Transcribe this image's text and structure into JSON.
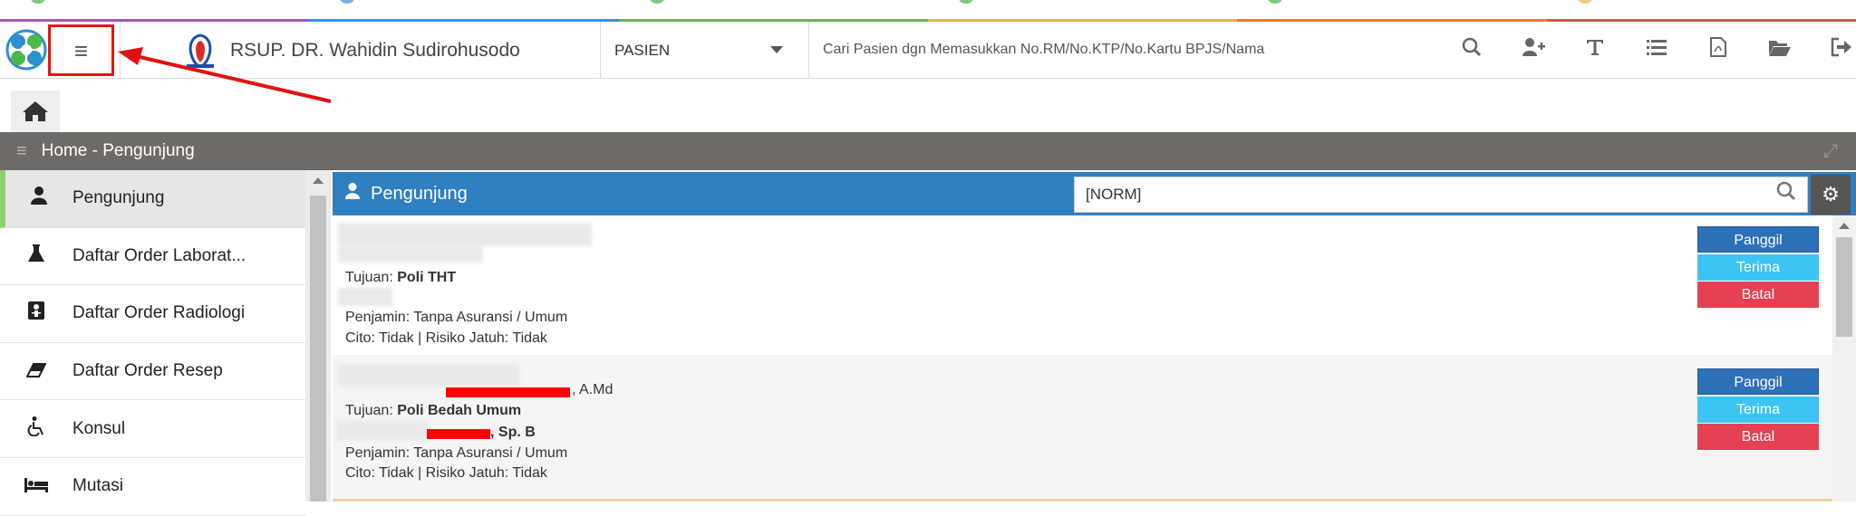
{
  "header": {
    "hospital_name": "RSUP. DR. Wahidin Sudirohusodo",
    "search_type": "PASIEN",
    "search_placeholder": "Cari Pasien dgn Memasukkan No.RM/No.KTP/No.Kartu BPJS/Nama",
    "menu_icon": "hamburger-icon",
    "toolbar_icons": [
      "search-icon",
      "add-user-icon",
      "text-icon",
      "list-icon",
      "pdf-icon",
      "folder-icon",
      "logout-icon"
    ]
  },
  "titlebar": {
    "title": "Home - Pengunjung"
  },
  "sidebar": {
    "items": [
      {
        "label": "Pengunjung",
        "icon": "user-icon",
        "active": true
      },
      {
        "label": "Daftar Order Laborat...",
        "icon": "flask-icon",
        "active": false
      },
      {
        "label": "Daftar Order Radiologi",
        "icon": "xray-icon",
        "active": false
      },
      {
        "label": "Daftar Order Resep",
        "icon": "eraser-icon",
        "active": false
      },
      {
        "label": "Konsul",
        "icon": "wheelchair-icon",
        "active": false
      },
      {
        "label": "Mutasi",
        "icon": "bed-icon",
        "active": false
      }
    ]
  },
  "panel": {
    "title": "Pengunjung",
    "norm_value": "[NORM]"
  },
  "visits": [
    {
      "name_suffix": "",
      "tujuan_label": "Tujuan: ",
      "tujuan": "Poli THT",
      "doctor_suffix": "",
      "penjamin": "Penjamin: Tanpa Asuransi / Umum",
      "cito": "Cito: Tidak | Risiko Jatuh: Tidak"
    },
    {
      "name_suffix": ", A.Md",
      "tujuan_label": "Tujuan: ",
      "tujuan": "Poli Bedah Umum",
      "doctor_suffix": ", Sp. B",
      "penjamin": "Penjamin: Tanpa Asuransi / Umum",
      "cito": "Cito: Tidak | Risiko Jatuh: Tidak"
    }
  ],
  "actions": {
    "panggil": "Panggil",
    "terima": "Terima",
    "batal": "Batal"
  },
  "colors": {
    "panel_header": "#2f7fc1",
    "titlebar": "#6e6a67",
    "panggil": "#2d71b8",
    "terima": "#3ec4f2",
    "batal": "#e54153",
    "active_marker": "#8bd06b",
    "annotation": "#e11111"
  }
}
